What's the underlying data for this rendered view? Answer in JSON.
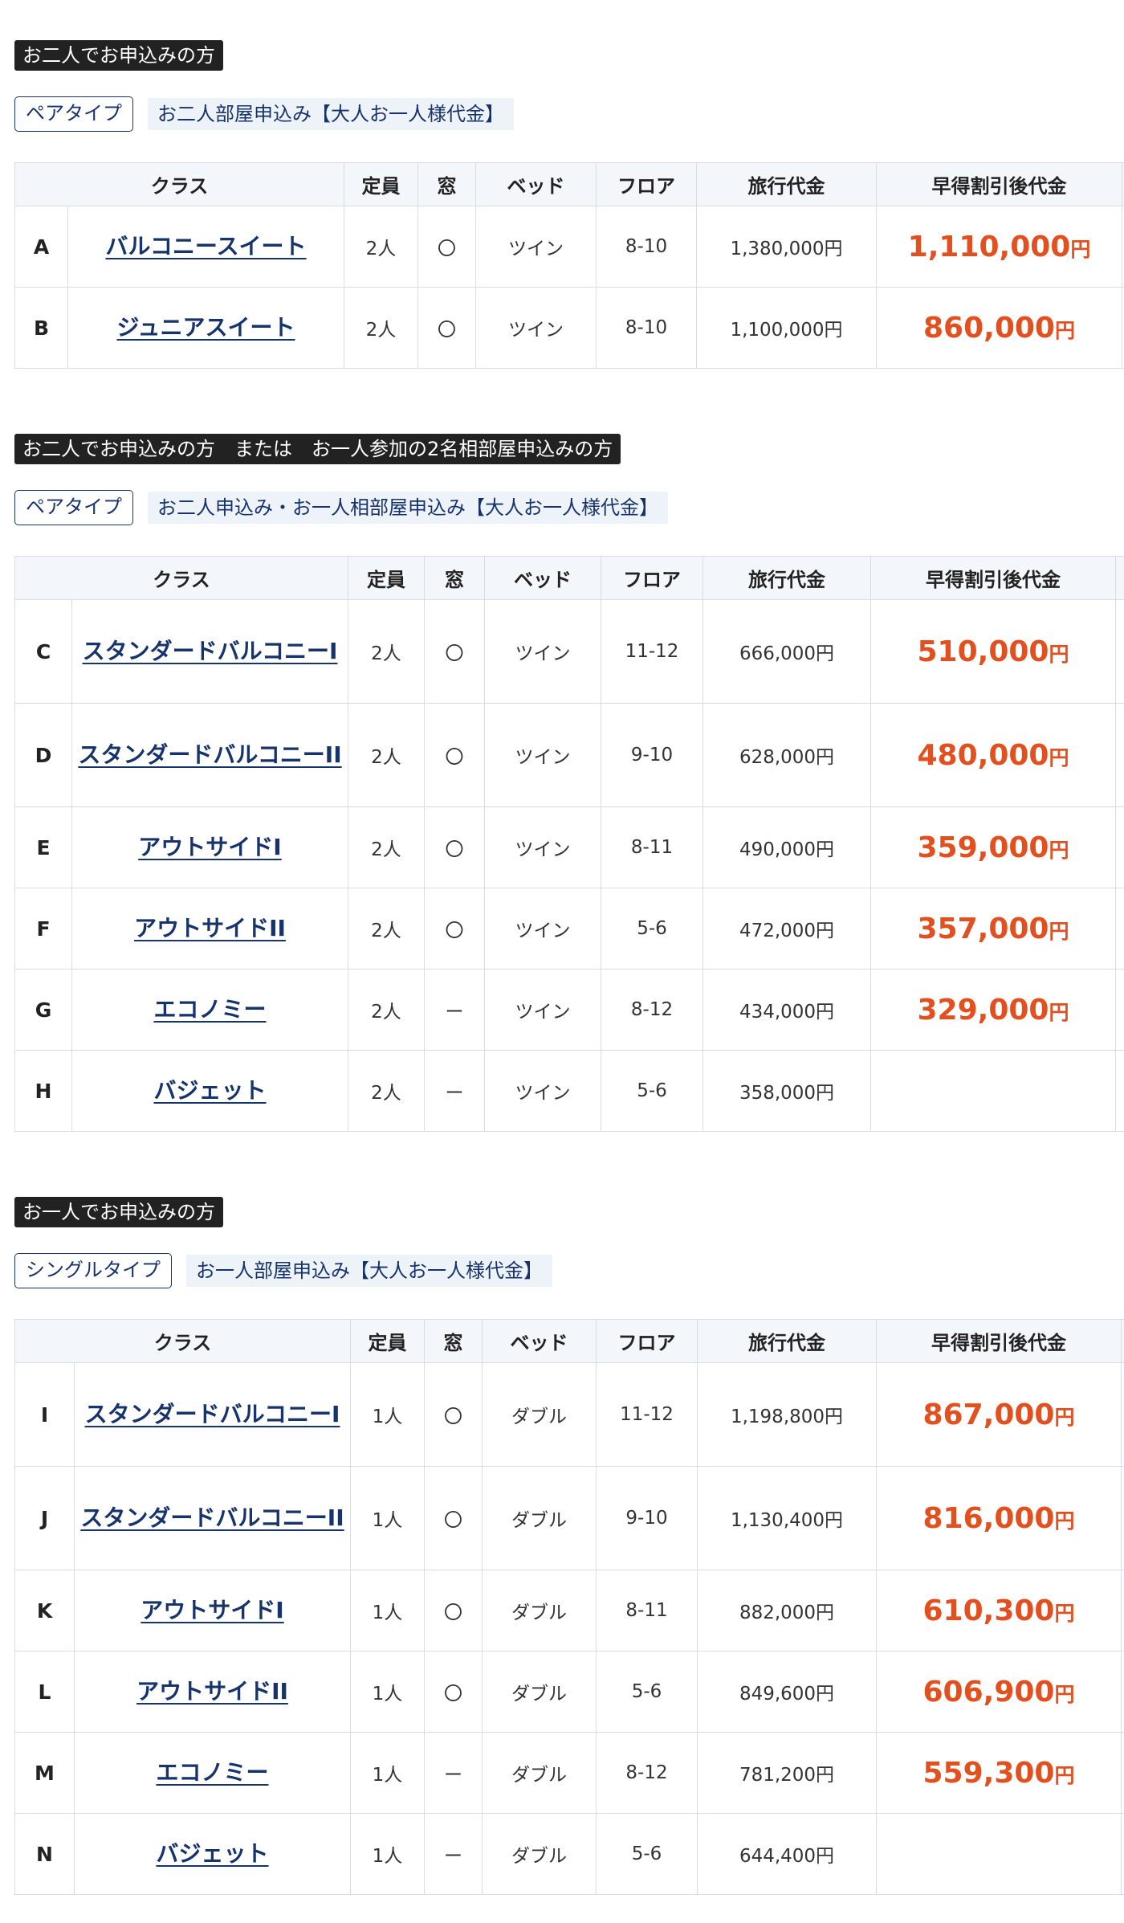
{
  "columns": {
    "class": "クラス",
    "capacity": "定員",
    "window": "窓",
    "bed": "ベッド",
    "floor": "フロア",
    "price": "旅行代金",
    "early": "早得割引後代金"
  },
  "yen": "円",
  "section1": {
    "heading": "お二人でお申込みの方",
    "type_tag": "ペアタイプ",
    "type_note": "お二人部屋申込み【大人お一人様代金】",
    "rows": [
      {
        "letter": "A",
        "name": "バルコニースイート",
        "capacity": "2人",
        "window": "〇",
        "bed": "ツイン",
        "floor": "8-10",
        "price": "1,380,000円",
        "early": "1,110,000"
      },
      {
        "letter": "B",
        "name": "ジュニアスイート",
        "capacity": "2人",
        "window": "〇",
        "bed": "ツイン",
        "floor": "8-10",
        "price": "1,100,000円",
        "early": "860,000"
      }
    ]
  },
  "section2": {
    "heading": "お二人でお申込みの方　または　お一人参加の2名相部屋申込みの方",
    "type_tag": "ペアタイプ",
    "type_note": "お二人申込み・お一人相部屋申込み【大人お一人様代金】",
    "rows": [
      {
        "letter": "C",
        "name": "スタンダードバルコニーI",
        "capacity": "2人",
        "window": "〇",
        "bed": "ツイン",
        "floor": "11-12",
        "price": "666,000円",
        "early": "510,000"
      },
      {
        "letter": "D",
        "name": "スタンダードバルコニーII",
        "capacity": "2人",
        "window": "〇",
        "bed": "ツイン",
        "floor": "9-10",
        "price": "628,000円",
        "early": "480,000"
      },
      {
        "letter": "E",
        "name": "アウトサイドI",
        "capacity": "2人",
        "window": "〇",
        "bed": "ツイン",
        "floor": "8-11",
        "price": "490,000円",
        "early": "359,000"
      },
      {
        "letter": "F",
        "name": "アウトサイドII",
        "capacity": "2人",
        "window": "〇",
        "bed": "ツイン",
        "floor": "5-6",
        "price": "472,000円",
        "early": "357,000"
      },
      {
        "letter": "G",
        "name": "エコノミー",
        "capacity": "2人",
        "window": "ー",
        "bed": "ツイン",
        "floor": "8-12",
        "price": "434,000円",
        "early": "329,000"
      },
      {
        "letter": "H",
        "name": "バジェット",
        "capacity": "2人",
        "window": "ー",
        "bed": "ツイン",
        "floor": "5-6",
        "price": "358,000円",
        "early": ""
      }
    ]
  },
  "section3": {
    "heading": "お一人でお申込みの方",
    "type_tag": "シングルタイプ",
    "type_note": "お一人部屋申込み【大人お一人様代金】",
    "rows": [
      {
        "letter": "I",
        "name": "スタンダードバルコニーI",
        "capacity": "1人",
        "window": "〇",
        "bed": "ダブル",
        "floor": "11-12",
        "price": "1,198,800円",
        "early": "867,000"
      },
      {
        "letter": "J",
        "name": "スタンダードバルコニーII",
        "capacity": "1人",
        "window": "〇",
        "bed": "ダブル",
        "floor": "9-10",
        "price": "1,130,400円",
        "early": "816,000"
      },
      {
        "letter": "K",
        "name": "アウトサイドI",
        "capacity": "1人",
        "window": "〇",
        "bed": "ダブル",
        "floor": "8-11",
        "price": "882,000円",
        "early": "610,300"
      },
      {
        "letter": "L",
        "name": "アウトサイドII",
        "capacity": "1人",
        "window": "〇",
        "bed": "ダブル",
        "floor": "5-6",
        "price": "849,600円",
        "early": "606,900"
      },
      {
        "letter": "M",
        "name": "エコノミー",
        "capacity": "1人",
        "window": "ー",
        "bed": "ダブル",
        "floor": "8-12",
        "price": "781,200円",
        "early": "559,300"
      },
      {
        "letter": "N",
        "name": "バジェット",
        "capacity": "1人",
        "window": "ー",
        "bed": "ダブル",
        "floor": "5-6",
        "price": "644,400円",
        "early": ""
      }
    ]
  }
}
